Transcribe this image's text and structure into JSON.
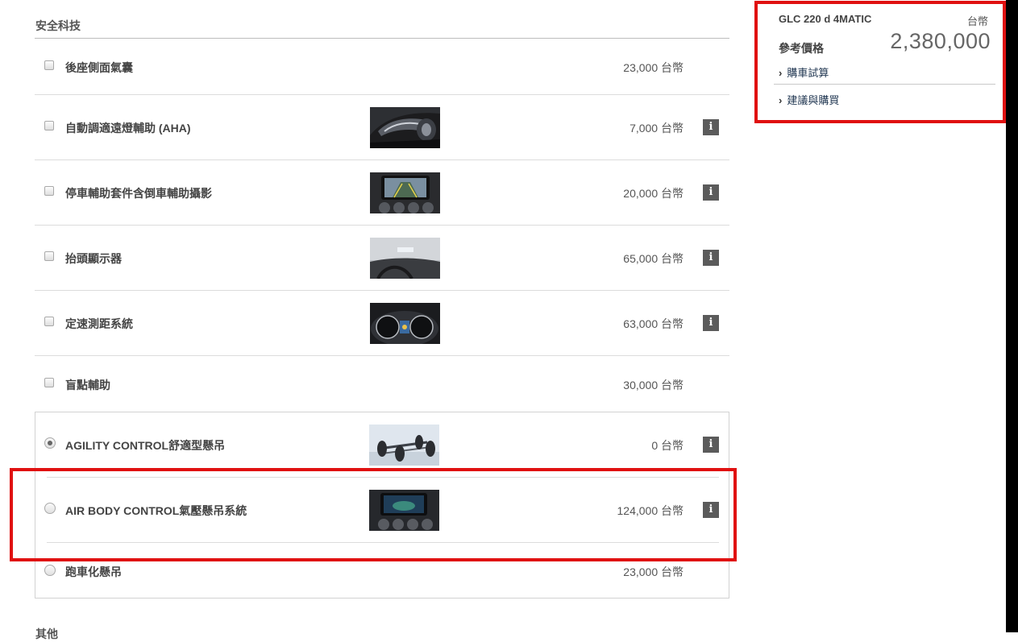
{
  "section": {
    "title": "安全科技"
  },
  "options": [
    {
      "label": "後座側面氣囊",
      "price": "23,000 台幣",
      "type": "checkbox",
      "checked": false
    },
    {
      "label": "自動調適遠燈輔助 (AHA)",
      "price": "7,000 台幣",
      "type": "checkbox",
      "checked": false,
      "image": "headlight-photo",
      "info": "i"
    },
    {
      "label": "停車輔助套件含倒車輔助攝影",
      "price": "20,000 台幣",
      "type": "checkbox",
      "checked": false,
      "image": "parking-camera-screen-photo",
      "info": "i"
    },
    {
      "label": "抬頭顯示器",
      "price": "65,000 台幣",
      "type": "checkbox",
      "checked": false,
      "image": "head-up-display-photo",
      "info": "i"
    },
    {
      "label": "定速測距系統",
      "price": "63,000 台幣",
      "type": "checkbox",
      "checked": false,
      "image": "instrument-cluster-photo",
      "info": "i"
    },
    {
      "label": "盲點輔助",
      "price": "30,000 台幣",
      "type": "checkbox",
      "checked": false
    }
  ],
  "suspension": [
    {
      "label": "AGILITY CONTROL舒適型懸吊",
      "price": "0 台幣",
      "type": "radio",
      "checked": true,
      "image": "chassis-photo",
      "info": "i"
    },
    {
      "label": "AIR BODY CONTROL氣壓懸吊系統",
      "price": "124,000 台幣",
      "type": "radio",
      "checked": false,
      "image": "dashboard-display-photo",
      "info": "i"
    },
    {
      "label": "跑車化懸吊",
      "price": "23,000 台幣",
      "type": "radio",
      "checked": false
    }
  ],
  "next_section": {
    "title": "其他"
  },
  "summary": {
    "model": "GLC 220 d 4MATIC",
    "currency": "台幣",
    "reference_price_label": "參考價格",
    "total_price": "2,380,000",
    "links": [
      {
        "label": "購車試算",
        "icon": "chevron-right-icon"
      },
      {
        "label": "建議與購買",
        "icon": "chevron-right-icon"
      }
    ]
  },
  "colors": {
    "highlight": "#e01010",
    "info_button": "#5b5b5b",
    "link": "#1f3550"
  }
}
